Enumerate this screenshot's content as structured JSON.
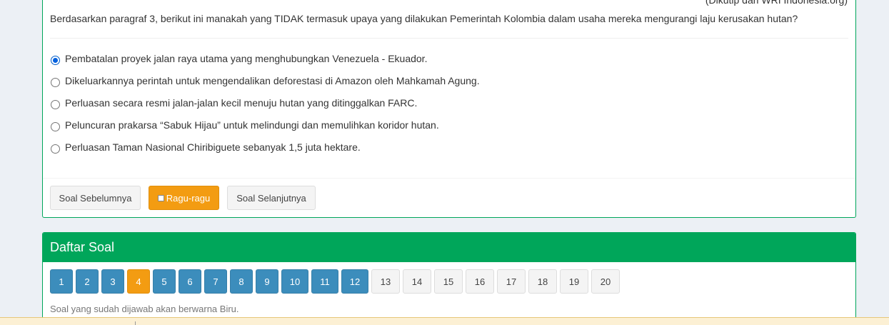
{
  "question": {
    "source": "(Dikutip dari WRI Indonesia.org)",
    "text": "Berdasarkan paragraf 3, berikut ini manakah yang TIDAK termasuk upaya yang dilakukan Pemerintah Kolombia dalam usaha mereka mengurangi laju kerusakan hutan?",
    "options": [
      {
        "label": "Pembatalan proyek jalan raya utama yang menghubungkan Venezuela - Ekuador.",
        "checked": true
      },
      {
        "label": "Dikeluarkannya perintah untuk mengendalikan deforestasi di Amazon oleh Mahkamah Agung.",
        "checked": false
      },
      {
        "label": "Perluasan secara resmi jalan-jalan kecil menuju hutan yang ditinggalkan FARC.",
        "checked": false
      },
      {
        "label": "Peluncuran prakarsa “Sabuk Hijau” untuk melindungi dan memulihkan koridor hutan.",
        "checked": false
      },
      {
        "label": "Perluasan Taman Nasional Chiribiguete sebanyak 1,5 juta hektare.",
        "checked": false
      }
    ]
  },
  "footer": {
    "prev_label": "Soal Sebelumnya",
    "doubt_label": "Ragu-ragu",
    "next_label": "Soal Selanjutnya"
  },
  "question_list": {
    "title": "Daftar Soal",
    "numbers": [
      {
        "n": "1",
        "state": "answered"
      },
      {
        "n": "2",
        "state": "answered"
      },
      {
        "n": "3",
        "state": "answered"
      },
      {
        "n": "4",
        "state": "current"
      },
      {
        "n": "5",
        "state": "answered"
      },
      {
        "n": "6",
        "state": "answered"
      },
      {
        "n": "7",
        "state": "answered"
      },
      {
        "n": "8",
        "state": "answered"
      },
      {
        "n": "9",
        "state": "answered"
      },
      {
        "n": "10",
        "state": "answered"
      },
      {
        "n": "11",
        "state": "answered"
      },
      {
        "n": "12",
        "state": "answered"
      },
      {
        "n": "13",
        "state": "empty"
      },
      {
        "n": "14",
        "state": "empty"
      },
      {
        "n": "15",
        "state": "empty"
      },
      {
        "n": "16",
        "state": "empty"
      },
      {
        "n": "17",
        "state": "empty"
      },
      {
        "n": "18",
        "state": "empty"
      },
      {
        "n": "19",
        "state": "empty"
      },
      {
        "n": "20",
        "state": "empty"
      }
    ],
    "hint": "Soal yang sudah dijawab akan berwarna Biru."
  },
  "colors": {
    "success_green": "#00a65a",
    "answered_blue": "#3c8dbc",
    "current_orange": "#f39c12"
  }
}
